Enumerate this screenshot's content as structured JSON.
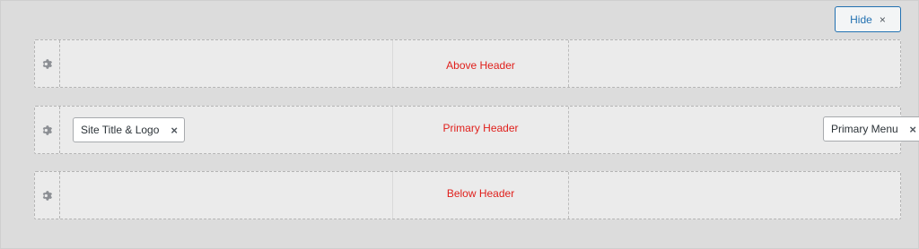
{
  "hide_button": {
    "label": "Hide",
    "close_glyph": "×"
  },
  "rows": [
    {
      "label": "Above Header",
      "icon": "gear-icon"
    },
    {
      "label": "Primary Header",
      "icon": "gear-icon",
      "left_item": {
        "label": "Site Title & Logo",
        "close_glyph": "×"
      },
      "right_item": {
        "label": "Primary Menu",
        "close_glyph": "×"
      }
    },
    {
      "label": "Below Header",
      "icon": "gear-icon"
    }
  ],
  "colors": {
    "accent": "#2271b1",
    "row_label": "#e0201c",
    "background": "#dcdcdc"
  }
}
